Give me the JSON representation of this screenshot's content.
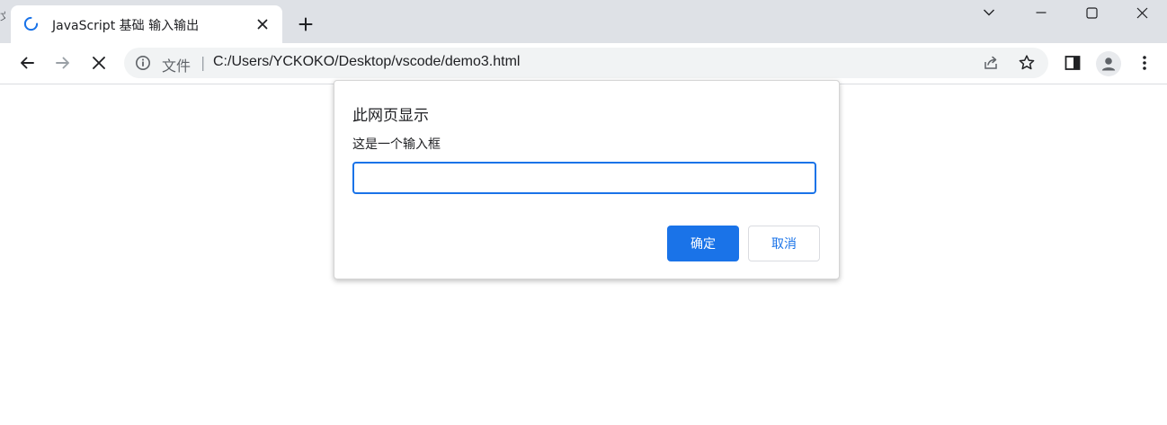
{
  "browser": {
    "tab": {
      "title": "JavaScript 基础 输入输出",
      "status": "loading"
    },
    "left_edge_glyph": "文",
    "address": {
      "scheme_label": "文件",
      "separator": "|",
      "url": "C:/Users/YCKOKO/Desktop/vscode/demo3.html"
    },
    "colors": {
      "accent": "#1a73e8",
      "tabstrip": "#dee1e6",
      "omnibox": "#f1f3f4"
    },
    "icons": [
      "loading-spinner-icon",
      "close-icon",
      "plus-icon",
      "chevron-down-icon",
      "minimize-icon",
      "maximize-icon",
      "close-window-icon",
      "back-arrow-icon",
      "forward-arrow-icon",
      "stop-icon",
      "info-icon",
      "share-icon",
      "star-icon",
      "side-panel-icon",
      "profile-icon",
      "kebab-menu-icon"
    ]
  },
  "dialog": {
    "title": "此网页显示",
    "message": "这是一个输入框",
    "input_value": "",
    "ok_label": "确定",
    "cancel_label": "取消"
  }
}
